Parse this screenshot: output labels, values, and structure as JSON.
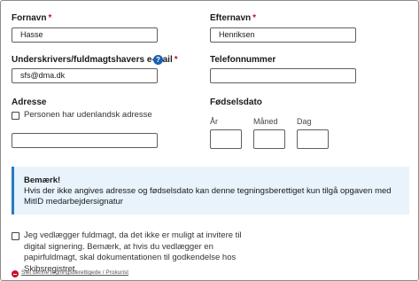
{
  "form": {
    "first_name": {
      "label": "Fornavn",
      "required_marker": "*",
      "value": "Hasse"
    },
    "last_name": {
      "label": "Efternavn",
      "required_marker": "*",
      "value": "Henriksen"
    },
    "email": {
      "label": "Underskrivers/fuldmagtshavers e-mail",
      "required_marker": "*",
      "value": "sfs@dma.dk",
      "help_icon": "?"
    },
    "phone": {
      "label": "Telefonnummer",
      "value": ""
    },
    "address": {
      "label": "Adresse",
      "foreign_checkbox_label": "Personen har udenlandsk adresse",
      "foreign_checked": false,
      "value": ""
    },
    "birthdate": {
      "label": "Fødselsdato",
      "year_label": "År",
      "month_label": "Måned",
      "day_label": "Dag",
      "year_value": "",
      "month_value": "",
      "day_value": ""
    },
    "notice": {
      "title": "Bemærk!",
      "text": "Hvis der ikke angives adresse og fødselsdato kan denne tegningsberettiget kun tilgå opgaven med MitID medarbejdersignatur"
    },
    "power_of_attorney": {
      "checked": false,
      "text": "Jeg vedlægger fuldmagt, da det ikke er muligt at invitere til digital signering. Bemærk, at hvis du vedlægger en papirfuldmagt, skal dokumentationen til godkendelse hos Skibsregistret."
    },
    "remove_link": "Slet denne tegningsberettigede / Prokurist"
  },
  "colors": {
    "required": "#c8102e",
    "info_background": "#e8f3fb",
    "info_border": "#2b7bbf",
    "help_icon": "#1a5fb4"
  },
  "icons": {
    "help": "question-circle-icon",
    "remove": "minus-circle-icon"
  }
}
